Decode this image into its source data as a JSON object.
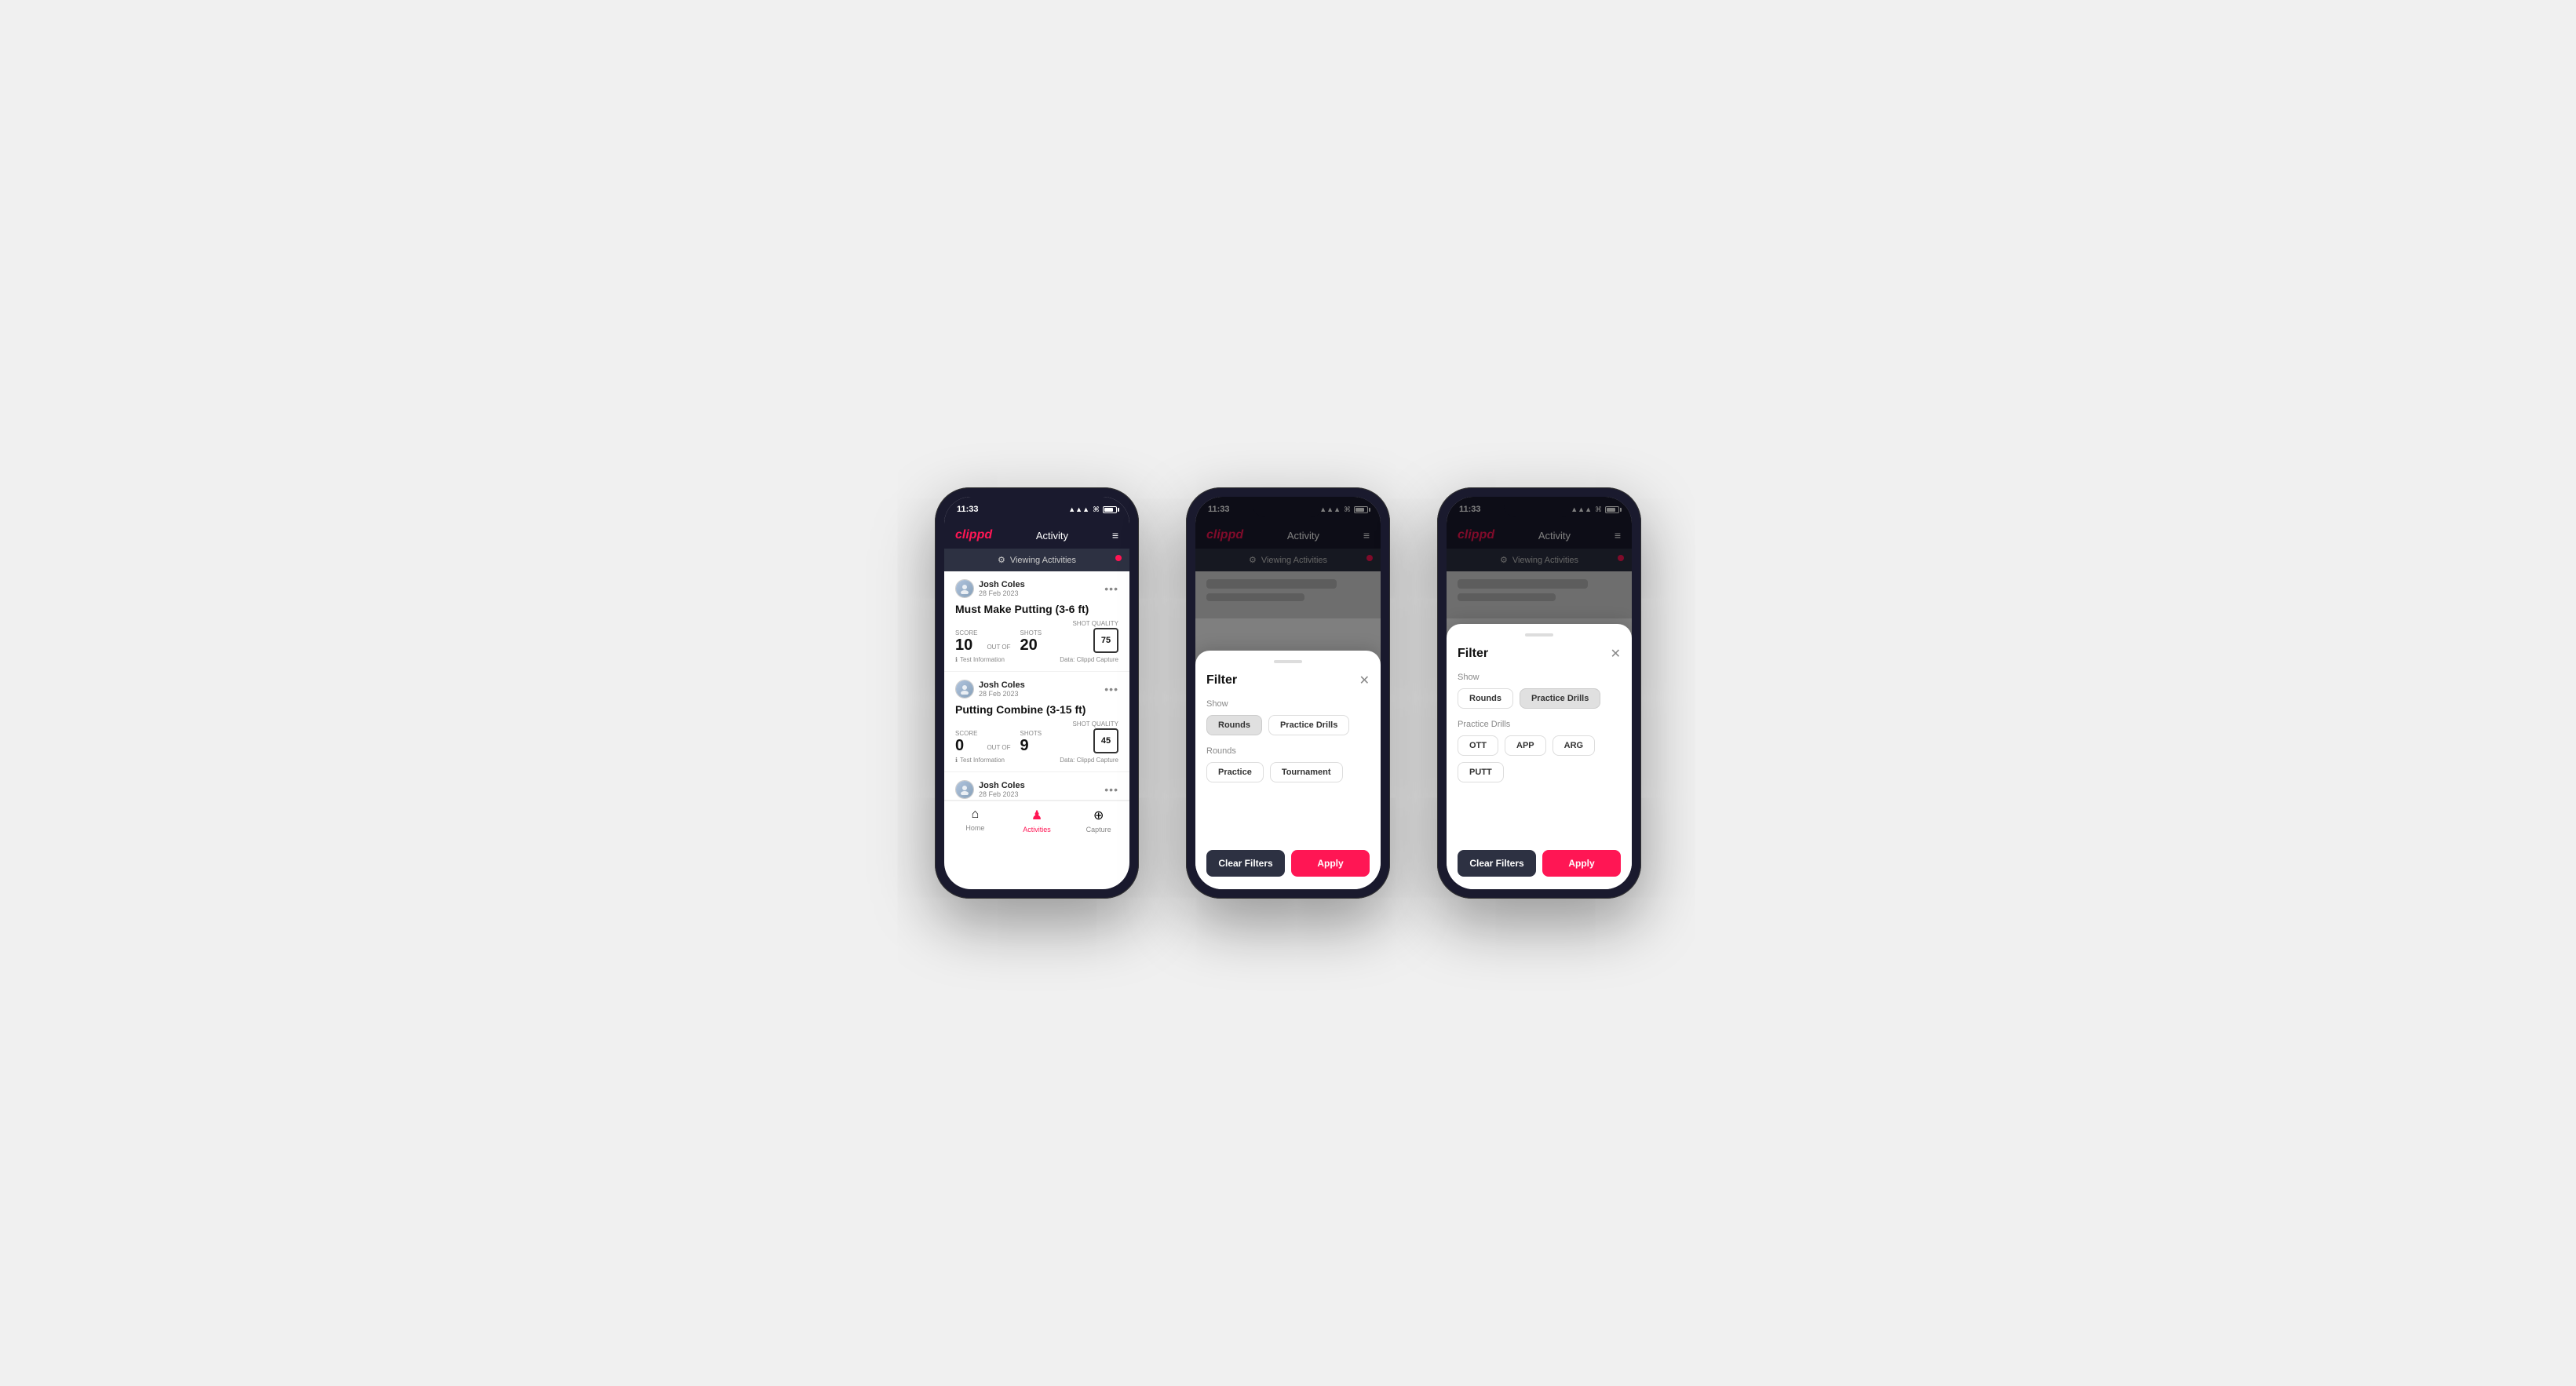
{
  "phones": [
    {
      "id": "phone1",
      "status": {
        "time": "11:33",
        "signal": "▲▲▲",
        "wifi": "wifi",
        "battery": 81
      },
      "header": {
        "logo": "clippd",
        "title": "Activity",
        "menu_icon": "≡"
      },
      "viewing_bar": {
        "icon": "⚙",
        "label": "Viewing Activities"
      },
      "activities": [
        {
          "user_name": "Josh Coles",
          "user_date": "28 Feb 2023",
          "title": "Must Make Putting (3-6 ft)",
          "score_label": "Score",
          "score_value": "10",
          "out_of_text": "OUT OF",
          "shots_label": "Shots",
          "shots_value": "20",
          "shot_quality_label": "Shot Quality",
          "shot_quality_value": "75",
          "info": "Test Information",
          "data_source": "Data: Clippd Capture"
        },
        {
          "user_name": "Josh Coles",
          "user_date": "28 Feb 2023",
          "title": "Putting Combine (3-15 ft)",
          "score_label": "Score",
          "score_value": "0",
          "out_of_text": "OUT OF",
          "shots_label": "Shots",
          "shots_value": "9",
          "shot_quality_label": "Shot Quality",
          "shot_quality_value": "45",
          "info": "Test Information",
          "data_source": "Data: Clippd Capture"
        },
        {
          "user_name": "Josh Coles",
          "user_date": "28 Feb 2023",
          "title": "",
          "score_label": "",
          "score_value": "",
          "out_of_text": "",
          "shots_label": "",
          "shots_value": "",
          "shot_quality_label": "",
          "shot_quality_value": "",
          "info": "",
          "data_source": ""
        }
      ],
      "tabs": [
        {
          "label": "Home",
          "icon": "⌂",
          "active": false
        },
        {
          "label": "Activities",
          "icon": "♟",
          "active": true
        },
        {
          "label": "Capture",
          "icon": "⊕",
          "active": false
        }
      ]
    },
    {
      "id": "phone2",
      "status": {
        "time": "11:33",
        "signal": "▲▲▲",
        "wifi": "wifi",
        "battery": 81
      },
      "header": {
        "logo": "clippd",
        "title": "Activity",
        "menu_icon": "≡"
      },
      "viewing_bar": {
        "icon": "⚙",
        "label": "Viewing Activities"
      },
      "filter": {
        "title": "Filter",
        "show_label": "Show",
        "show_options": [
          "Rounds",
          "Practice Drills"
        ],
        "show_active": "Rounds",
        "rounds_label": "Rounds",
        "rounds_options": [
          "Practice",
          "Tournament"
        ],
        "rounds_active": "",
        "clear_label": "Clear Filters",
        "apply_label": "Apply"
      }
    },
    {
      "id": "phone3",
      "status": {
        "time": "11:33",
        "signal": "▲▲▲",
        "wifi": "wifi",
        "battery": 81
      },
      "header": {
        "logo": "clippd",
        "title": "Activity",
        "menu_icon": "≡"
      },
      "viewing_bar": {
        "icon": "⚙",
        "label": "Viewing Activities"
      },
      "filter": {
        "title": "Filter",
        "show_label": "Show",
        "show_options": [
          "Rounds",
          "Practice Drills"
        ],
        "show_active": "Practice Drills",
        "drills_label": "Practice Drills",
        "drills_options": [
          "OTT",
          "APP",
          "ARG",
          "PUTT"
        ],
        "drills_active": "",
        "clear_label": "Clear Filters",
        "apply_label": "Apply"
      }
    }
  ]
}
